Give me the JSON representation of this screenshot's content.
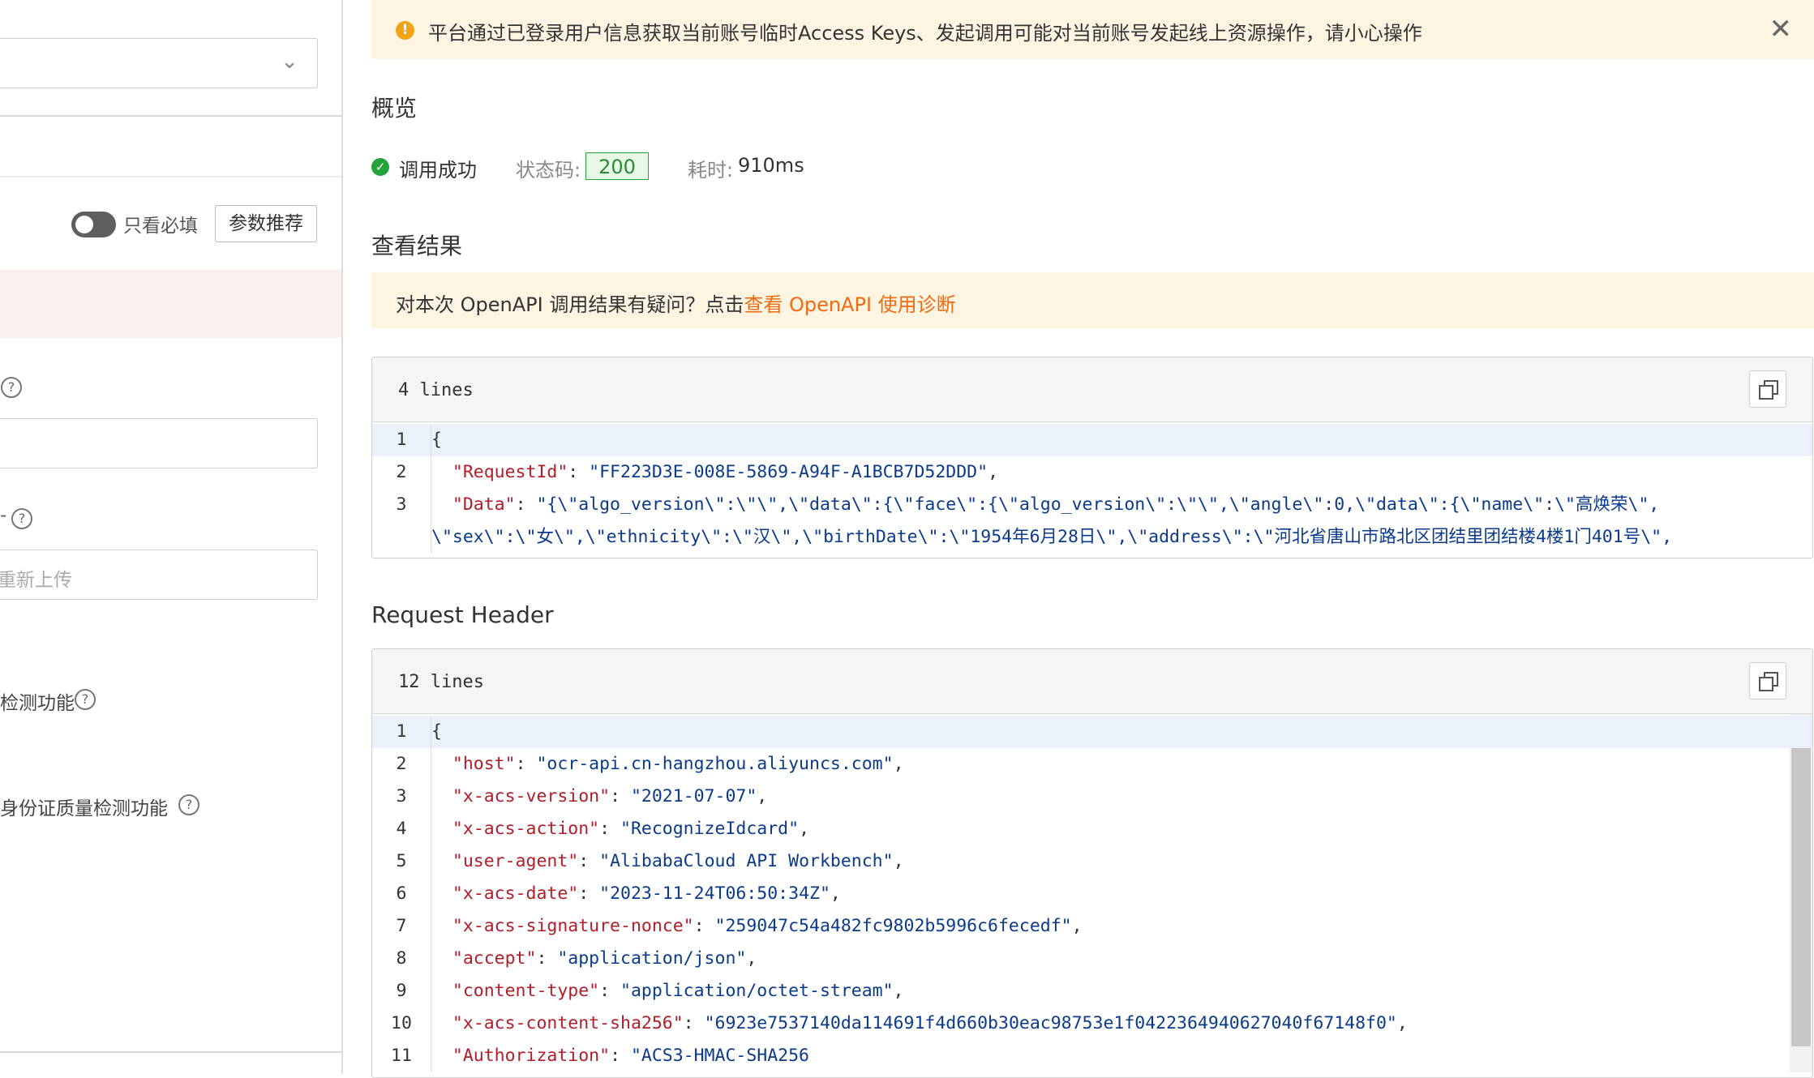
{
  "left": {
    "toggle_label": "只看必填",
    "recommend_button": "参数推荐",
    "file_placeholder": "重新上传",
    "option1_label": "检测功能",
    "option2_label": "身份证质量检测功能",
    "field_dash": "-"
  },
  "notice": {
    "message": "平台通过已登录用户信息获取当前账号临时Access Keys、发起调用可能对当前账号发起线上资源操作，请小心操作"
  },
  "overview": {
    "title": "概览",
    "success_text": "调用成功",
    "status_label": "状态码:",
    "status_code": "200",
    "duration_label": "耗时:",
    "duration": "910ms"
  },
  "result": {
    "title": "查看结果",
    "diag_prefix": "对本次 OpenAPI 调用结果有疑问？点击",
    "diag_link": "查看 OpenAPI 使用诊断",
    "lines_label": "4 lines",
    "code": [
      {
        "n": "1",
        "parts": [
          {
            "c": "punc",
            "t": "{"
          }
        ]
      },
      {
        "n": "2",
        "parts": [
          {
            "c": "punc",
            "t": "  "
          },
          {
            "c": "key",
            "t": "\"RequestId\""
          },
          {
            "c": "punc",
            "t": ": "
          },
          {
            "c": "str",
            "t": "\"FF223D3E-008E-5869-A94F-A1BCB7D52DDD\""
          },
          {
            "c": "punc",
            "t": ","
          }
        ]
      },
      {
        "n": "3",
        "parts": [
          {
            "c": "punc",
            "t": "  "
          },
          {
            "c": "key",
            "t": "\"Data\""
          },
          {
            "c": "punc",
            "t": ": "
          },
          {
            "c": "str",
            "t": "\"{\\\"algo_version\\\":\\\"\\\",\\\"data\\\":{\\\"face\\\":{\\\"algo_version\\\":\\\"\\\",\\\"angle\\\":0,\\\"data\\\":{\\\"name\\\":\\\"高焕荣\\\","
          }
        ]
      },
      {
        "n": "",
        "parts": [
          {
            "c": "str",
            "t": "\\\"sex\\\":\\\"女\\\",\\\"ethnicity\\\":\\\"汉\\\",\\\"birthDate\\\":\\\"1954年6月28日\\\",\\\"address\\\":\\\"河北省唐山市路北区团结里团结楼4楼1门401号\\\","
          }
        ]
      }
    ]
  },
  "request_header": {
    "title": "Request Header",
    "lines_label": "12 lines",
    "code": [
      {
        "n": "1",
        "parts": [
          {
            "c": "punc",
            "t": "{"
          }
        ]
      },
      {
        "n": "2",
        "parts": [
          {
            "c": "punc",
            "t": "  "
          },
          {
            "c": "key",
            "t": "\"host\""
          },
          {
            "c": "punc",
            "t": ": "
          },
          {
            "c": "str",
            "t": "\"ocr-api.cn-hangzhou.aliyuncs.com\""
          },
          {
            "c": "punc",
            "t": ","
          }
        ]
      },
      {
        "n": "3",
        "parts": [
          {
            "c": "punc",
            "t": "  "
          },
          {
            "c": "key",
            "t": "\"x-acs-version\""
          },
          {
            "c": "punc",
            "t": ": "
          },
          {
            "c": "str",
            "t": "\"2021-07-07\""
          },
          {
            "c": "punc",
            "t": ","
          }
        ]
      },
      {
        "n": "4",
        "parts": [
          {
            "c": "punc",
            "t": "  "
          },
          {
            "c": "key",
            "t": "\"x-acs-action\""
          },
          {
            "c": "punc",
            "t": ": "
          },
          {
            "c": "str",
            "t": "\"RecognizeIdcard\""
          },
          {
            "c": "punc",
            "t": ","
          }
        ]
      },
      {
        "n": "5",
        "parts": [
          {
            "c": "punc",
            "t": "  "
          },
          {
            "c": "key",
            "t": "\"user-agent\""
          },
          {
            "c": "punc",
            "t": ": "
          },
          {
            "c": "str",
            "t": "\"AlibabaCloud API Workbench\""
          },
          {
            "c": "punc",
            "t": ","
          }
        ]
      },
      {
        "n": "6",
        "parts": [
          {
            "c": "punc",
            "t": "  "
          },
          {
            "c": "key",
            "t": "\"x-acs-date\""
          },
          {
            "c": "punc",
            "t": ": "
          },
          {
            "c": "str",
            "t": "\"2023-11-24T06:50:34Z\""
          },
          {
            "c": "punc",
            "t": ","
          }
        ]
      },
      {
        "n": "7",
        "parts": [
          {
            "c": "punc",
            "t": "  "
          },
          {
            "c": "key",
            "t": "\"x-acs-signature-nonce\""
          },
          {
            "c": "punc",
            "t": ": "
          },
          {
            "c": "str",
            "t": "\"259047c54a482fc9802b5996c6fecedf\""
          },
          {
            "c": "punc",
            "t": ","
          }
        ]
      },
      {
        "n": "8",
        "parts": [
          {
            "c": "punc",
            "t": "  "
          },
          {
            "c": "key",
            "t": "\"accept\""
          },
          {
            "c": "punc",
            "t": ": "
          },
          {
            "c": "str",
            "t": "\"application/json\""
          },
          {
            "c": "punc",
            "t": ","
          }
        ]
      },
      {
        "n": "9",
        "parts": [
          {
            "c": "punc",
            "t": "  "
          },
          {
            "c": "key",
            "t": "\"content-type\""
          },
          {
            "c": "punc",
            "t": ": "
          },
          {
            "c": "str",
            "t": "\"application/octet-stream\""
          },
          {
            "c": "punc",
            "t": ","
          }
        ]
      },
      {
        "n": "10",
        "parts": [
          {
            "c": "punc",
            "t": "  "
          },
          {
            "c": "key",
            "t": "\"x-acs-content-sha256\""
          },
          {
            "c": "punc",
            "t": ": "
          },
          {
            "c": "str",
            "t": "\"6923e7537140da114691f4d660b30eac98753e1f0422364940627040f67148f0\""
          },
          {
            "c": "punc",
            "t": ","
          }
        ]
      },
      {
        "n": "11",
        "parts": [
          {
            "c": "punc",
            "t": "  "
          },
          {
            "c": "key",
            "t": "\"Authorization\""
          },
          {
            "c": "punc",
            "t": ": "
          },
          {
            "c": "str",
            "t": "\"ACS3-HMAC-SHA256"
          }
        ]
      }
    ]
  },
  "icons": {
    "warning": "warning-icon",
    "close": "close-icon",
    "success": "check-circle-icon",
    "copy": "copy-icon",
    "help": "help-circle-icon",
    "chevron": "chevron-down-icon"
  },
  "colors": {
    "accent_link": "#f06a12",
    "success": "#23a33a",
    "warning": "#f2a316",
    "notice_bg": "#fdf5e2"
  }
}
